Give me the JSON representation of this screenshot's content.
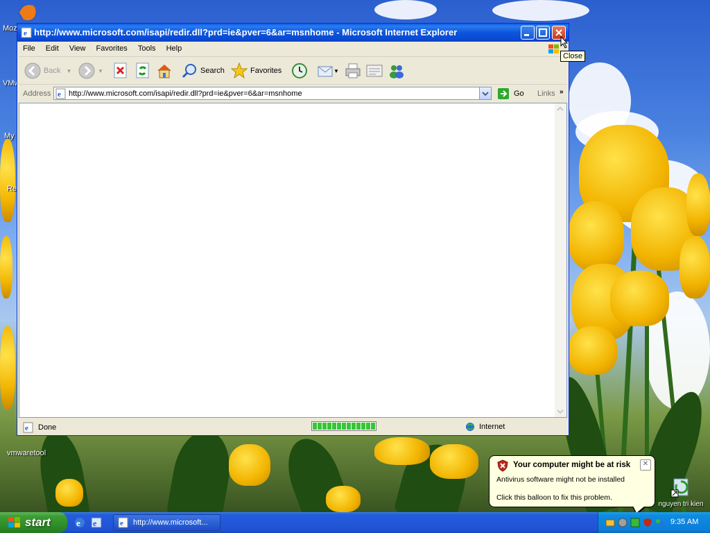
{
  "desktop": {
    "icons": [
      {
        "label": "Moz",
        "icon": "firefox-icon"
      },
      {
        "label": "VMw",
        "icon": "vmware-icon"
      },
      {
        "label": "My",
        "icon": "my-computer-icon"
      },
      {
        "label": "Re",
        "icon": "recycle-bin-icon"
      },
      {
        "label": "vmwaretool",
        "icon": "vmwaretool-icon"
      },
      {
        "label": "nguyen tri kien",
        "icon": "shortcut-icon"
      }
    ]
  },
  "window": {
    "title": "http://www.microsoft.com/isapi/redir.dll?prd=ie&pver=6&ar=msnhome - Microsoft Internet Explorer",
    "menu": [
      "File",
      "Edit",
      "View",
      "Favorites",
      "Tools",
      "Help"
    ],
    "toolbar": {
      "back": "Back",
      "search": "Search",
      "favorites": "Favorites"
    },
    "address": {
      "label": "Address",
      "value": "http://www.microsoft.com/isapi/redir.dll?prd=ie&pver=6&ar=msnhome",
      "go": "Go",
      "links": "Links"
    },
    "status": {
      "text": "Done",
      "progress": 1.0,
      "zone": "Internet"
    },
    "tooltip": "Close"
  },
  "balloon": {
    "title": "Your computer might be at risk",
    "line1": "Antivirus software might not be installed",
    "line2": "Click this balloon to fix this problem."
  },
  "taskbar": {
    "start": "start",
    "task_label": "http://www.microsoft...",
    "clock": "9:35 AM"
  },
  "colors": {
    "titlebar": "#0a5ae8",
    "start": "#3c9d34",
    "balloon_bg": "#ffffe1"
  }
}
